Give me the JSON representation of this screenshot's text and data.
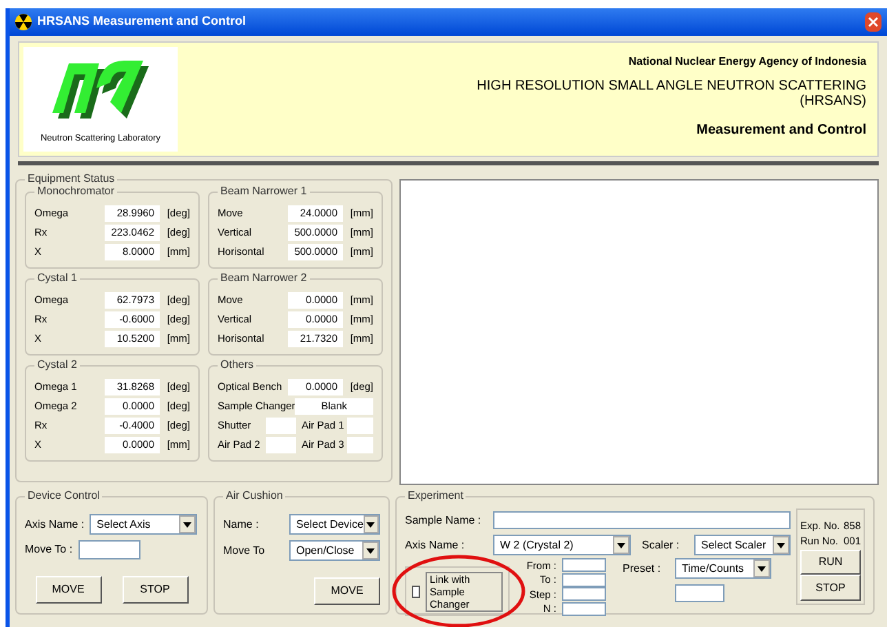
{
  "window": {
    "title": "HRSANS Measurement and Control"
  },
  "header": {
    "logo_caption": "Neutron Scattering Laboratory",
    "agency": "National Nuclear Energy Agency of Indonesia",
    "title": "HIGH RESOLUTION SMALL ANGLE NEUTRON SCATTERING (HRSANS)",
    "subtitle": "Measurement and Control"
  },
  "equipment_status": {
    "title": "Equipment Status",
    "left_groups": [
      {
        "title": "Monochromator",
        "rows": [
          {
            "kind": "field",
            "label": "Omega",
            "value": "28.9960",
            "unit": "[deg]"
          },
          {
            "kind": "field",
            "label": "Rx",
            "value": "223.0462",
            "unit": "[deg]"
          },
          {
            "kind": "field",
            "label": "X",
            "value": "8.0000",
            "unit": "[mm]"
          }
        ]
      },
      {
        "title": "Cystal 1",
        "rows": [
          {
            "kind": "field",
            "label": "Omega",
            "value": "62.7973",
            "unit": "[deg]"
          },
          {
            "kind": "field",
            "label": "Rx",
            "value": "-0.6000",
            "unit": "[deg]"
          },
          {
            "kind": "field",
            "label": "X",
            "value": "10.5200",
            "unit": "[mm]"
          }
        ]
      },
      {
        "title": "Cystal 2",
        "rows": [
          {
            "kind": "field",
            "label": "Omega 1",
            "value": "31.8268",
            "unit": "[deg]"
          },
          {
            "kind": "field",
            "label": "Omega 2",
            "value": "0.0000",
            "unit": "[deg]"
          },
          {
            "kind": "field",
            "label": "Rx",
            "value": "-0.4000",
            "unit": "[deg]"
          },
          {
            "kind": "field",
            "label": "X",
            "value": "0.0000",
            "unit": "[mm]"
          }
        ]
      }
    ],
    "right_groups": [
      {
        "title": "Beam Narrower 1",
        "rows": [
          {
            "kind": "field",
            "label": "Move",
            "value": "24.0000",
            "unit": "[mm]"
          },
          {
            "kind": "field",
            "label": "Vertical",
            "value": "500.0000",
            "unit": "[mm]"
          },
          {
            "kind": "field",
            "label": "Horisontal",
            "value": "500.0000",
            "unit": "[mm]"
          }
        ]
      },
      {
        "title": "Beam Narrower 2",
        "rows": [
          {
            "kind": "field",
            "label": "Move",
            "value": "0.0000",
            "unit": "[mm]"
          },
          {
            "kind": "field",
            "label": "Vertical",
            "value": "0.0000",
            "unit": "[mm]"
          },
          {
            "kind": "field",
            "label": "Horisontal",
            "value": "21.7320",
            "unit": "[mm]"
          }
        ]
      },
      {
        "title": "Others",
        "rows": [
          {
            "kind": "field",
            "label": "Optical Bench",
            "value": "0.0000",
            "unit": "[deg]"
          },
          {
            "kind": "text",
            "label": "Sample Changer",
            "value": "Blank"
          },
          {
            "kind": "pair",
            "label": "Shutter",
            "label2": "Air Pad 1"
          },
          {
            "kind": "pair",
            "label": "Air Pad 2",
            "label2": "Air Pad 3"
          }
        ]
      }
    ]
  },
  "device_control": {
    "title": "Device Control",
    "axis_label": "Axis Name :",
    "axis_value": "Select Axis",
    "move_label": "Move To :",
    "buttons": [
      "MOVE",
      "STOP"
    ]
  },
  "air_cushion": {
    "title": "Air Cushion",
    "name_label": "Name :",
    "name_value": "Select Device",
    "move_label": "Move To",
    "move_value": "Open/Close",
    "button": "MOVE"
  },
  "experiment": {
    "title": "Experiment",
    "sample_label": "Sample Name :",
    "axis_label": "Axis Name :",
    "axis_value": "W 2 (Crystal 2)",
    "link_label": "Link with Sample Changer",
    "link_checked": false,
    "scan_labels": [
      "From :",
      "To :",
      "Step :",
      "N :"
    ],
    "scaler_label": "Scaler :",
    "scaler_value": "Select Scaler",
    "preset_label": "Preset :",
    "preset_value": "Time/Counts",
    "exp_label": "Exp. No.",
    "exp_value": "858",
    "run_label": "Run No.",
    "run_value": "001",
    "buttons": [
      "RUN",
      "STOP"
    ]
  }
}
